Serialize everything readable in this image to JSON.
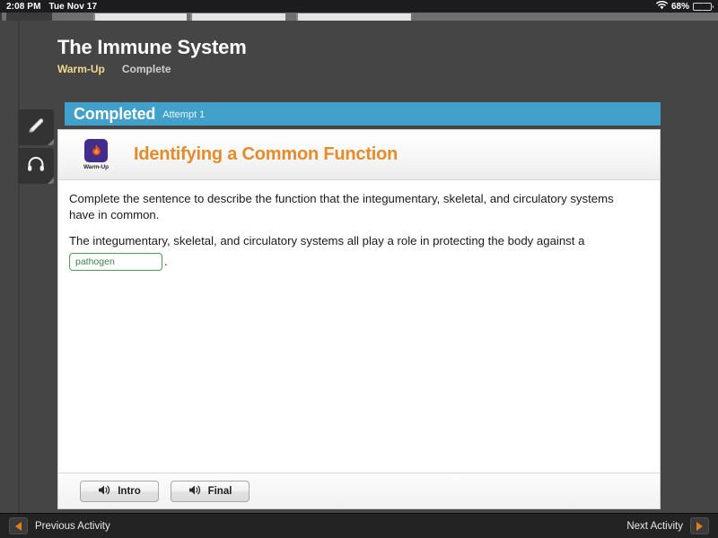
{
  "status_bar": {
    "time": "2:08 PM",
    "date": "Tue Nov 17",
    "wifi_icon": "wifi-icon",
    "battery_percent": "68%",
    "battery_icon": "battery-charging-icon",
    "battery_color": "#4cd435"
  },
  "tools": {
    "pencil_icon": "pencil-icon",
    "headphones_icon": "headphones-icon"
  },
  "activity": {
    "title": "The Immune System",
    "section_label": "Warm-Up",
    "status_label": "Complete",
    "section_color": "#f2d98f"
  },
  "banner": {
    "state": "Completed",
    "attempt": "Attempt 1",
    "color": "#42a1ca"
  },
  "card": {
    "badge_caption": "Warm-Up",
    "badge_icon": "flame-icon",
    "badge_color": "#432d8c",
    "title": "Identifying a Common Function",
    "title_color": "#e78b2a",
    "prompt": "Complete the sentence to describe the function that the integumentary, skeletal, and circulatory systems have in common.",
    "sentence_stem": "The integumentary, skeletal, and circulatory systems all play a role in protecting the body against a",
    "answer_value": "pathogen",
    "answer_placeholder": "",
    "answer_border_color": "#4e9c5a",
    "answer_text_color": "#3b8349",
    "sentence_end": "."
  },
  "footer": {
    "intro_label": "Intro",
    "final_label": "Final",
    "speaker_icon": "speaker-icon"
  },
  "bottom_nav": {
    "previous_label": "Previous Activity",
    "next_label": "Next Activity",
    "prev_icon": "triangle-left-icon",
    "next_icon": "triangle-right-icon",
    "arrow_color": "#e07b1f"
  }
}
